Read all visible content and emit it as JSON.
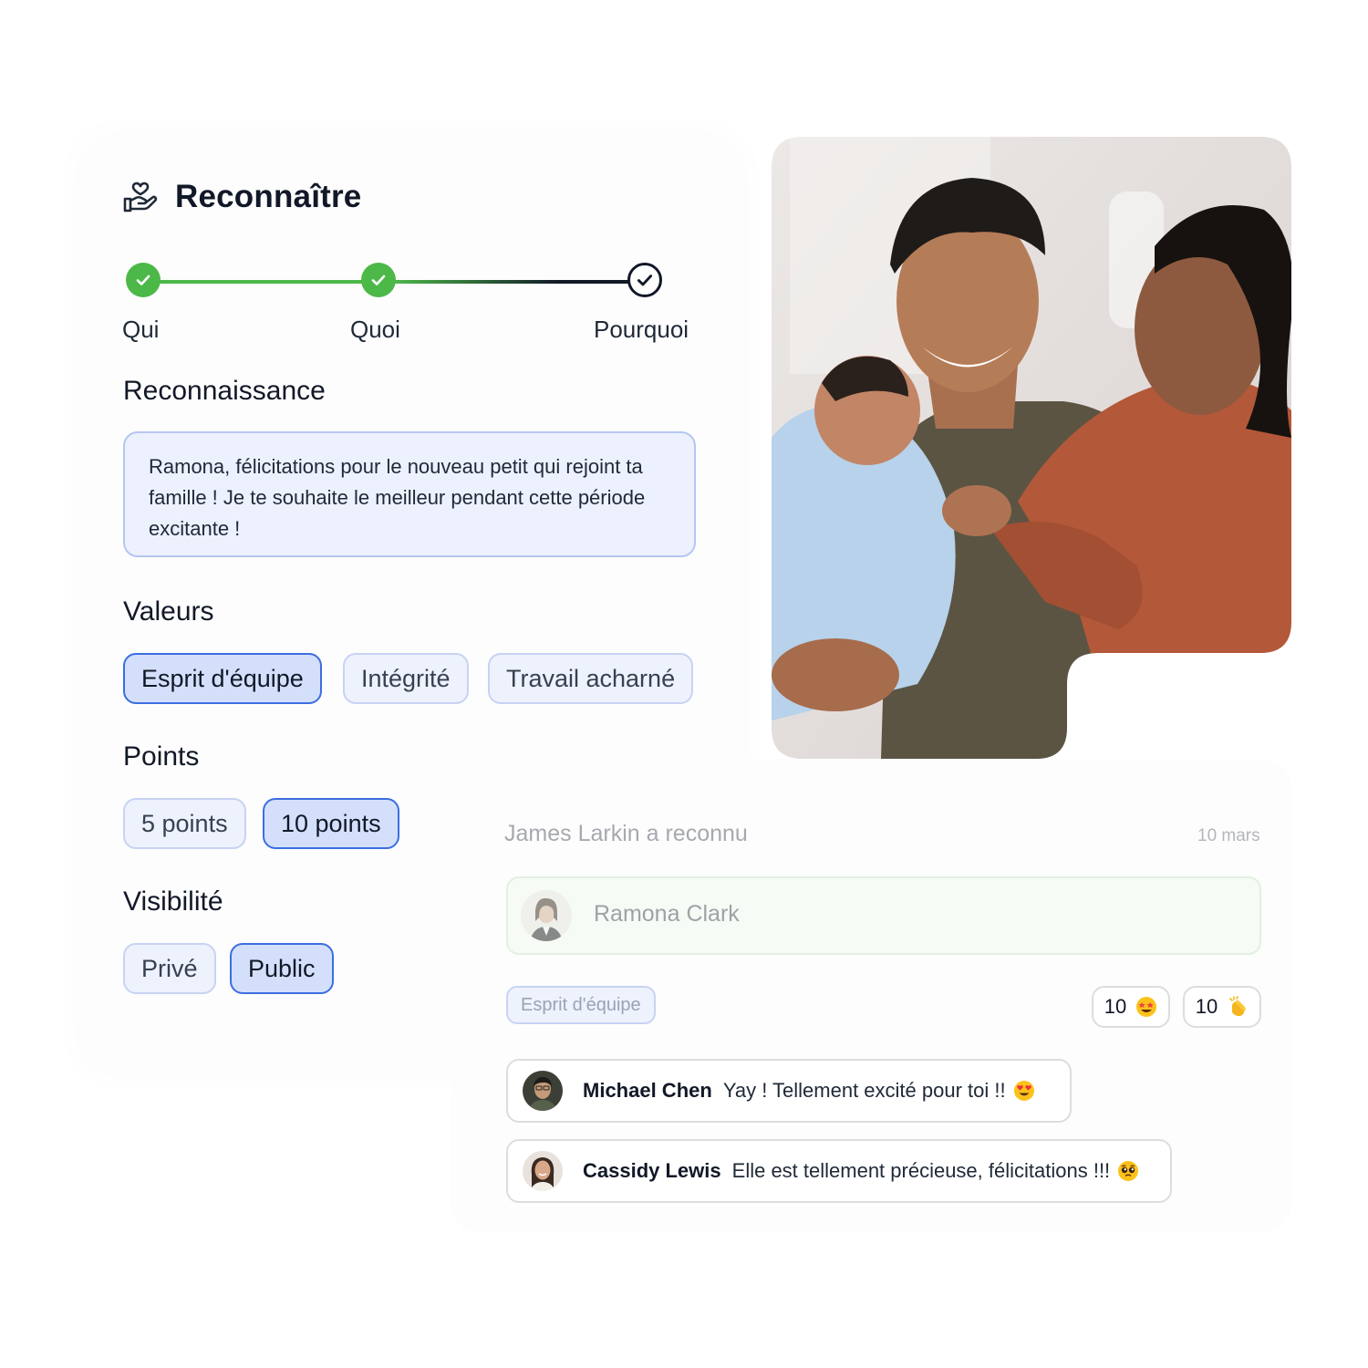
{
  "form": {
    "title": "Reconnaître",
    "title_icon": "hand-heart-icon",
    "steps": [
      {
        "label": "Qui",
        "status": "done"
      },
      {
        "label": "Quoi",
        "status": "done"
      },
      {
        "label": "Pourquoi",
        "status": "current"
      }
    ],
    "recognition_heading": "Reconnaissance",
    "recognition_message": "Ramona, félicitations pour le nouveau petit qui rejoint ta famille ! Je te souhaite le meilleur pendant cette période excitante !",
    "values_heading": "Valeurs",
    "values": [
      {
        "label": "Esprit d'équipe",
        "selected": true
      },
      {
        "label": "Intégrité",
        "selected": false
      },
      {
        "label": "Travail acharné",
        "selected": false
      }
    ],
    "points_heading": "Points",
    "points": [
      {
        "label": "5 points",
        "selected": false
      },
      {
        "label": "10 points",
        "selected": true
      }
    ],
    "visibility_heading": "Visibilité",
    "visibility": [
      {
        "label": "Privé",
        "selected": false
      },
      {
        "label": "Public",
        "selected": true
      }
    ]
  },
  "feed": {
    "header": "James Larkin a reconnu",
    "date": "10 mars",
    "recipient": "Ramona Clark",
    "value_tag": "Esprit d'équipe",
    "reactions": [
      {
        "count": "10",
        "emoji": "star-struck-emoji"
      },
      {
        "count": "10",
        "emoji": "clapping-hands-emoji"
      }
    ],
    "comments": [
      {
        "name": "Michael Chen",
        "text": "Yay ! Tellement excité pour toi !!",
        "emoji": "heart-eyes-emoji"
      },
      {
        "name": "Cassidy Lewis",
        "text": "Elle est tellement précieuse, félicitations !!!",
        "emoji": "pleading-face-emoji"
      }
    ]
  },
  "colors": {
    "accent_green": "#4cb848",
    "accent_blue": "#3c6ee0",
    "chip_bg": "#eef2fd",
    "chip_selected_bg": "#d4e0fb"
  }
}
